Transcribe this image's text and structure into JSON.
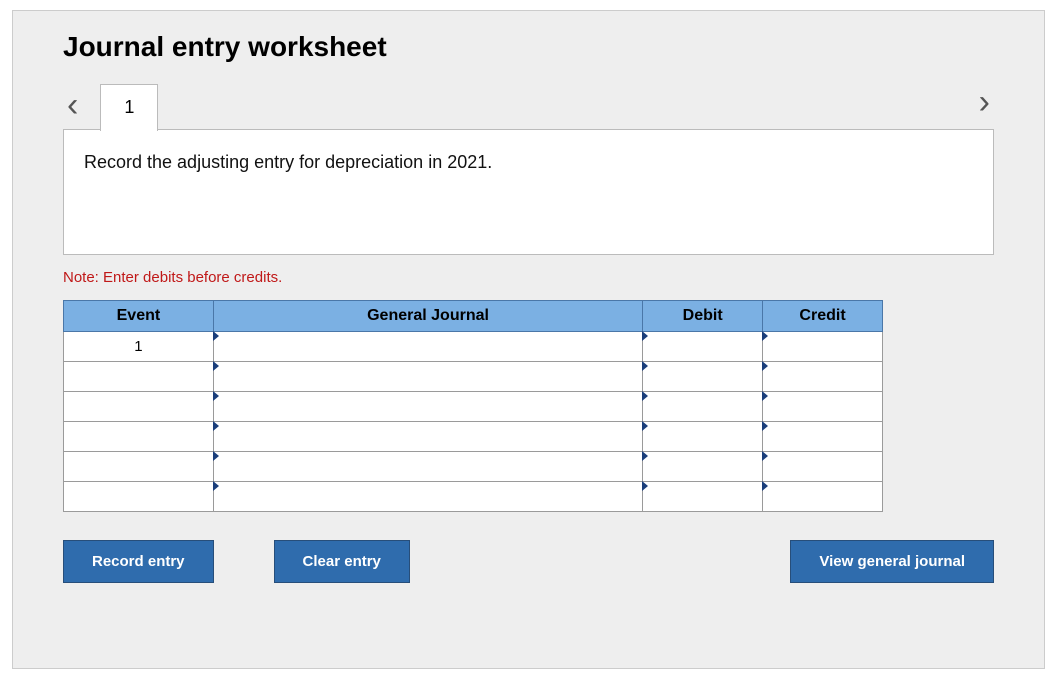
{
  "title": "Journal entry worksheet",
  "nav": {
    "prev_icon": "‹",
    "next_icon": "›",
    "tabs": [
      "1"
    ]
  },
  "description": "Record the adjusting entry for depreciation in 2021.",
  "note": "Note: Enter debits before credits.",
  "table": {
    "headers": {
      "event": "Event",
      "general_journal": "General Journal",
      "debit": "Debit",
      "credit": "Credit"
    },
    "rows": [
      {
        "event": "1",
        "general_journal": "",
        "debit": "",
        "credit": ""
      },
      {
        "event": "",
        "general_journal": "",
        "debit": "",
        "credit": ""
      },
      {
        "event": "",
        "general_journal": "",
        "debit": "",
        "credit": ""
      },
      {
        "event": "",
        "general_journal": "",
        "debit": "",
        "credit": ""
      },
      {
        "event": "",
        "general_journal": "",
        "debit": "",
        "credit": ""
      },
      {
        "event": "",
        "general_journal": "",
        "debit": "",
        "credit": ""
      }
    ]
  },
  "buttons": {
    "record": "Record entry",
    "clear": "Clear entry",
    "view": "View general journal"
  }
}
